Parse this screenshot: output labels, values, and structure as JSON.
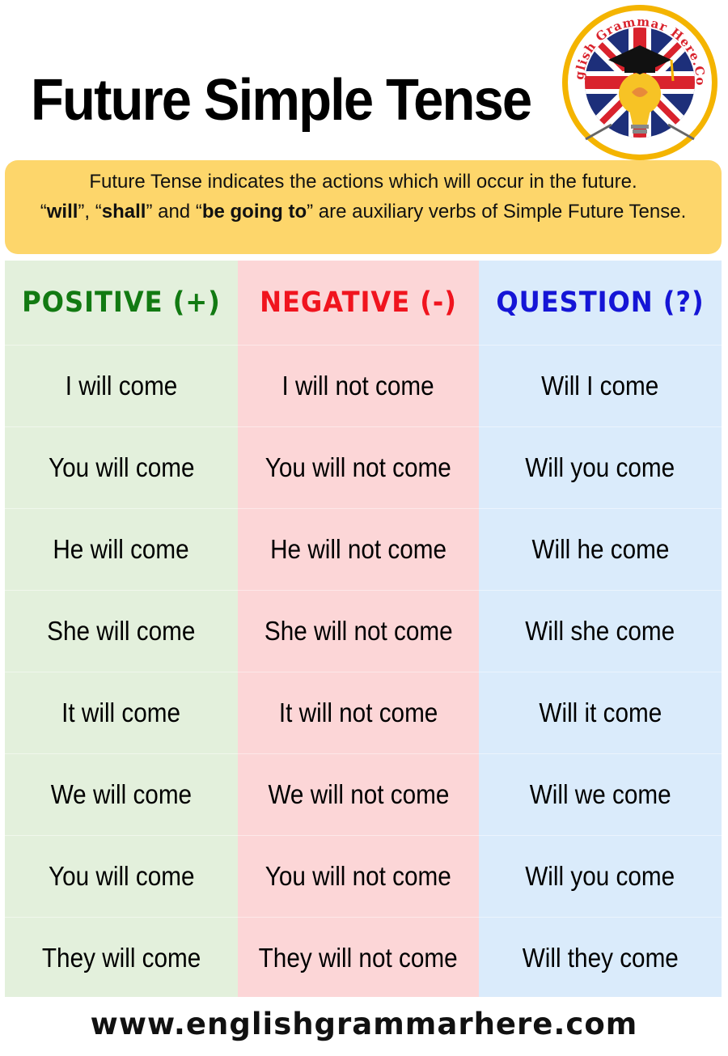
{
  "title": "Future Simple Tense",
  "logo": {
    "text": "English Grammar Here.Com",
    "colors": {
      "ring": "#f4b400",
      "red": "#d9232d",
      "blue": "#1d2f7a"
    }
  },
  "info": {
    "line1": "Future Tense  indicates the actions which will occur in the future.",
    "q_open": "“",
    "will": "will",
    "sep1": "”, “",
    "shall": "shall",
    "sep2": "”  and “",
    "be_going_to": "be going to",
    "rest": "” are auxiliary verbs of Simple Future Tense."
  },
  "columns": {
    "positive": {
      "header": "POSITIVE (+)",
      "color": "#127a12",
      "rows": [
        "I will come",
        "You will come",
        "He will come",
        "She will come",
        "It will come",
        "We will come",
        "You will come",
        "They will come"
      ]
    },
    "negative": {
      "header": "NEGATIVE (-)",
      "color": "#f0141e",
      "rows": [
        "I will not come",
        "You will not come",
        "He will not come",
        "She will not come",
        "It will not come",
        "We will not come",
        "You will not come",
        "They will not come"
      ]
    },
    "question": {
      "header": "QUESTION (?)",
      "color": "#1515d6",
      "rows": [
        "Will I come",
        "Will you come",
        "Will he come",
        "Will she come",
        "Will it come",
        "Will we come",
        "Will you come",
        "Will they come"
      ]
    }
  },
  "footer": "www.englishgrammarhere.com"
}
